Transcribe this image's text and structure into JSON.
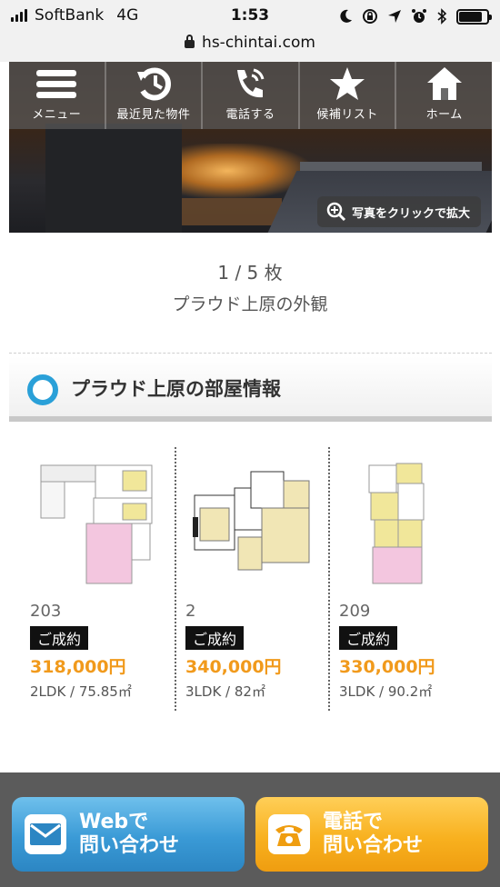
{
  "status_bar": {
    "carrier": "SoftBank",
    "network": "4G",
    "time": "1:53",
    "battery_level": 0.85,
    "icons": [
      "signal-icon",
      "moon-icon",
      "rotation-lock-icon",
      "location-arrow-icon",
      "alarm-icon",
      "bluetooth-icon",
      "battery-icon"
    ]
  },
  "browser": {
    "url": "hs-chintai.com",
    "lock_icon": "lock-icon"
  },
  "nav": {
    "items": [
      {
        "label": "メニュー",
        "icon": "menu-icon"
      },
      {
        "label": "最近見た物件",
        "icon": "history-icon"
      },
      {
        "label": "電話する",
        "icon": "phone-icon"
      },
      {
        "label": "候補リスト",
        "icon": "star-icon"
      },
      {
        "label": "ホーム",
        "icon": "home-icon"
      }
    ]
  },
  "gallery": {
    "zoom_hint": "写真をクリックで拡大",
    "counter": "1 / 5 枚",
    "caption": "プラウド上原の外観"
  },
  "section": {
    "title": "プラウド上原の部屋情報",
    "accent": "#2aa0d8"
  },
  "rooms": [
    {
      "number": "203",
      "status": "ご成約",
      "price": "318,000円",
      "spec": "2LDK / 75.85㎡"
    },
    {
      "number": "2",
      "status": "ご成約",
      "price": "340,000円",
      "spec": "3LDK / 82㎡"
    },
    {
      "number": "209",
      "status": "ご成約",
      "price": "330,000円",
      "spec": "3LDK / 90.2㎡"
    }
  ],
  "cta": {
    "web": {
      "line1": "Webで",
      "line2": "問い合わせ",
      "icon": "mail-icon",
      "color": "#3a9ad6"
    },
    "tel": {
      "line1": "電話で",
      "line2": "問い合わせ",
      "icon": "telephone-icon",
      "color": "#f8b11f"
    }
  },
  "colors": {
    "price": "#f19a1c",
    "badge": "#111111",
    "cta_bar": "#5b5b5b"
  }
}
